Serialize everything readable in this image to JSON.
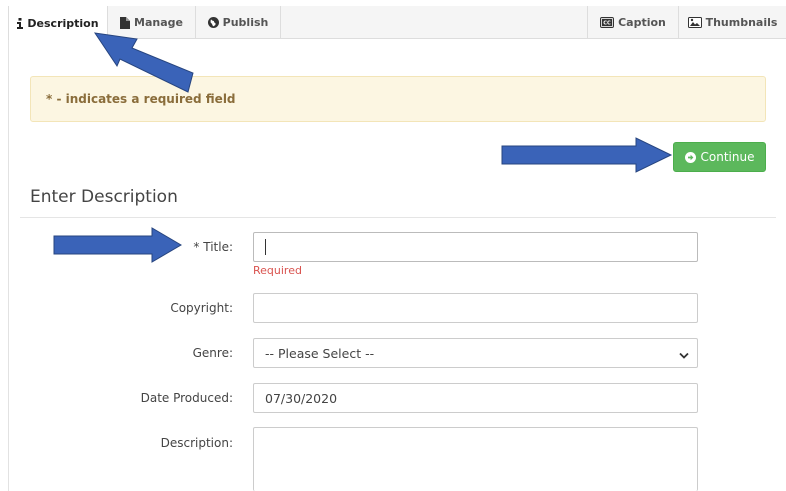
{
  "tabs": {
    "description": "Description",
    "manage": "Manage",
    "publish": "Publish",
    "caption": "Caption",
    "thumbnails": "Thumbnails"
  },
  "alert": {
    "text": "* - indicates a required field"
  },
  "continue_label": "Continue",
  "section_title": "Enter Description",
  "form": {
    "title_label": "* Title:",
    "title_value": "",
    "title_error": "Required",
    "copyright_label": "Copyright:",
    "copyright_value": "",
    "genre_label": "Genre:",
    "genre_selected": "-- Please Select --",
    "date_label": "Date Produced:",
    "date_value": "07/30/2020",
    "description_label": "Description:",
    "description_value": ""
  },
  "colors": {
    "accent_green": "#5cb85c",
    "alert_bg": "#fcf6e2",
    "alert_text": "#8a6d3b",
    "error_red": "#d9534f",
    "annotation_arrow": "#3a63b8"
  },
  "icons": [
    "info-icon",
    "file-icon",
    "globe-icon",
    "closed-caption-icon",
    "image-icon",
    "arrow-circle-right-icon",
    "chevron-down-icon"
  ]
}
